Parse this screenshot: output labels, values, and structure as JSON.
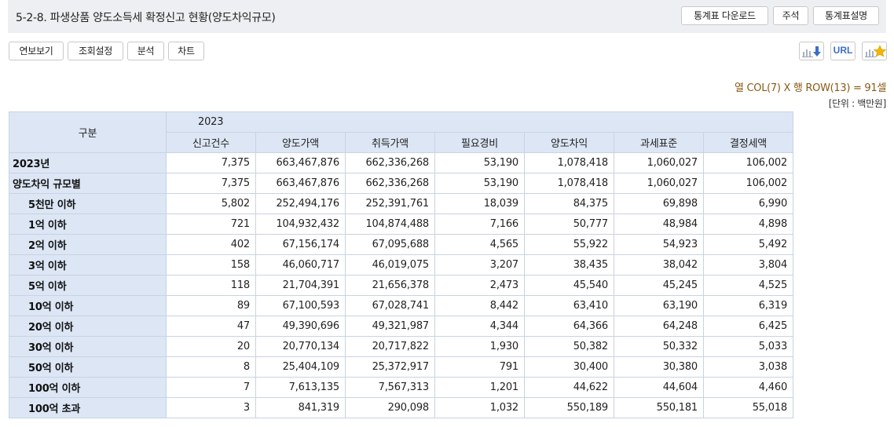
{
  "title": "5-2-8. 파생상품 양도소득세 확정신고 현황(양도차익규모)",
  "top_buttons": {
    "download": "통계표 다운로드",
    "notes": "주석",
    "description": "통계표설명"
  },
  "toolbar": {
    "yearly_view": "연보보기",
    "query_settings": "조회설정",
    "analysis": "분석",
    "chart": "차트",
    "url": "URL"
  },
  "icons": {
    "download": "chart-download-icon",
    "url": "url-link-icon",
    "favorite": "chart-star-icon"
  },
  "colors": {
    "header_bg": "#dce6f5",
    "border": "#c8d3e3",
    "title_bar_bg": "#eeeff2",
    "cell_info_text": "#8a5a14",
    "url_blue": "#3a6fc9",
    "star": "#f5b400"
  },
  "info": {
    "cells": "열 COL(7) X 행 ROW(13) = 91셀",
    "unit": "[단위 : 백만원]"
  },
  "table": {
    "category_header": "구분",
    "year": "2023",
    "columns": [
      "신고건수",
      "양도가액",
      "취득가액",
      "필요경비",
      "양도차익",
      "과세표준",
      "결정세액"
    ],
    "rows": [
      {
        "label": "2023년",
        "indent": false,
        "values": [
          "7,375",
          "663,467,876",
          "662,336,268",
          "53,190",
          "1,078,418",
          "1,060,027",
          "106,002"
        ]
      },
      {
        "label": "양도차익 규모별",
        "indent": false,
        "values": [
          "7,375",
          "663,467,876",
          "662,336,268",
          "53,190",
          "1,078,418",
          "1,060,027",
          "106,002"
        ]
      },
      {
        "label": "5천만 이하",
        "indent": true,
        "values": [
          "5,802",
          "252,494,176",
          "252,391,761",
          "18,039",
          "84,375",
          "69,898",
          "6,990"
        ]
      },
      {
        "label": "1억 이하",
        "indent": true,
        "values": [
          "721",
          "104,932,432",
          "104,874,488",
          "7,166",
          "50,777",
          "48,984",
          "4,898"
        ]
      },
      {
        "label": "2억 이하",
        "indent": true,
        "values": [
          "402",
          "67,156,174",
          "67,095,688",
          "4,565",
          "55,922",
          "54,923",
          "5,492"
        ]
      },
      {
        "label": "3억 이하",
        "indent": true,
        "values": [
          "158",
          "46,060,717",
          "46,019,075",
          "3,207",
          "38,435",
          "38,042",
          "3,804"
        ]
      },
      {
        "label": "5억 이하",
        "indent": true,
        "values": [
          "118",
          "21,704,391",
          "21,656,378",
          "2,473",
          "45,540",
          "45,245",
          "4,525"
        ]
      },
      {
        "label": "10억 이하",
        "indent": true,
        "values": [
          "89",
          "67,100,593",
          "67,028,741",
          "8,442",
          "63,410",
          "63,190",
          "6,319"
        ]
      },
      {
        "label": "20억 이하",
        "indent": true,
        "values": [
          "47",
          "49,390,696",
          "49,321,987",
          "4,344",
          "64,366",
          "64,248",
          "6,425"
        ]
      },
      {
        "label": "30억 이하",
        "indent": true,
        "values": [
          "20",
          "20,770,134",
          "20,717,822",
          "1,930",
          "50,382",
          "50,332",
          "5,033"
        ]
      },
      {
        "label": "50억 이하",
        "indent": true,
        "values": [
          "8",
          "25,404,109",
          "25,372,917",
          "791",
          "30,400",
          "30,380",
          "3,038"
        ]
      },
      {
        "label": "100억 이하",
        "indent": true,
        "values": [
          "7",
          "7,613,135",
          "7,567,313",
          "1,201",
          "44,622",
          "44,604",
          "4,460"
        ]
      },
      {
        "label": "100억 초과",
        "indent": true,
        "values": [
          "3",
          "841,319",
          "290,098",
          "1,032",
          "550,189",
          "550,181",
          "55,018"
        ]
      }
    ]
  }
}
